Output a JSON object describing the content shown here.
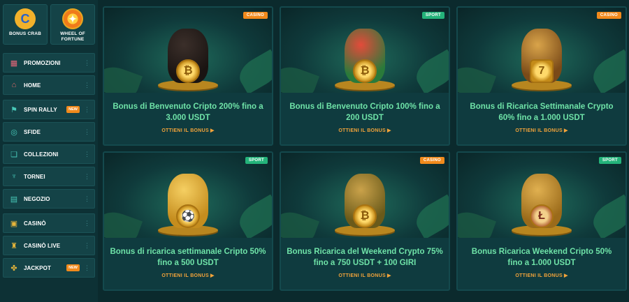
{
  "sidebar": {
    "tiles": [
      {
        "label": "BONUS CRAB",
        "icon": "crab-coin-icon"
      },
      {
        "label": "WHEEL OF FORTUNE",
        "icon": "wheel-icon"
      }
    ],
    "groups": [
      [
        {
          "label": "PROMOZIONI",
          "icon": "gift-icon",
          "badge": ""
        },
        {
          "label": "HOME",
          "icon": "home-icon",
          "badge": ""
        }
      ],
      [
        {
          "label": "SPIN RALLY",
          "icon": "flag-icon",
          "badge": "NEW"
        },
        {
          "label": "SFIDE",
          "icon": "target-icon",
          "badge": ""
        },
        {
          "label": "COLLEZIONI",
          "icon": "collection-icon",
          "badge": ""
        },
        {
          "label": "TORNEI",
          "icon": "trophy-icon",
          "badge": ""
        },
        {
          "label": "NEGOZIO",
          "icon": "shop-icon",
          "badge": ""
        }
      ],
      [
        {
          "label": "CASINÒ",
          "icon": "casino-icon",
          "badge": ""
        },
        {
          "label": "CASINÒ LIVE",
          "icon": "live-icon",
          "badge": ""
        },
        {
          "label": "JACKPOT",
          "icon": "clover-icon",
          "badge": "NEW"
        }
      ]
    ]
  },
  "cards": [
    {
      "tag": "CASINO",
      "tag_type": "casino",
      "coin": "₿",
      "title": "Bonus di Benvenuto Cripto 200% fino a 3.000 USDT",
      "cta": "OTTIENI IL BONUS"
    },
    {
      "tag": "SPORT",
      "tag_type": "sport",
      "coin": "₿",
      "title": "Bonus di Benvenuto Cripto 100% fino a 200 USDT",
      "cta": "OTTIENI IL BONUS"
    },
    {
      "tag": "CASINO",
      "tag_type": "casino",
      "coin": "7",
      "title": "Bonus di Ricarica Settimanale Crypto 60% fino a 1.000 USDT",
      "cta": "OTTIENI IL BONUS"
    },
    {
      "tag": "SPORT",
      "tag_type": "sport",
      "coin": "⚽",
      "title": "Bonus di ricarica settimanale Cripto 50% fino a 500 USDT",
      "cta": "OTTIENI IL BONUS"
    },
    {
      "tag": "CASINO",
      "tag_type": "casino",
      "coin": "₿",
      "title": "Bonus Ricarica del Weekend Crypto 75% fino a 750 USDT + 100 GIRI",
      "cta": "OTTIENI IL BONUS"
    },
    {
      "tag": "SPORT",
      "tag_type": "sport",
      "coin": "Ł",
      "title": "Bonus Ricarica Weekend Cripto 50% fino a 1.000 USDT",
      "cta": "OTTIENI IL BONUS"
    }
  ]
}
